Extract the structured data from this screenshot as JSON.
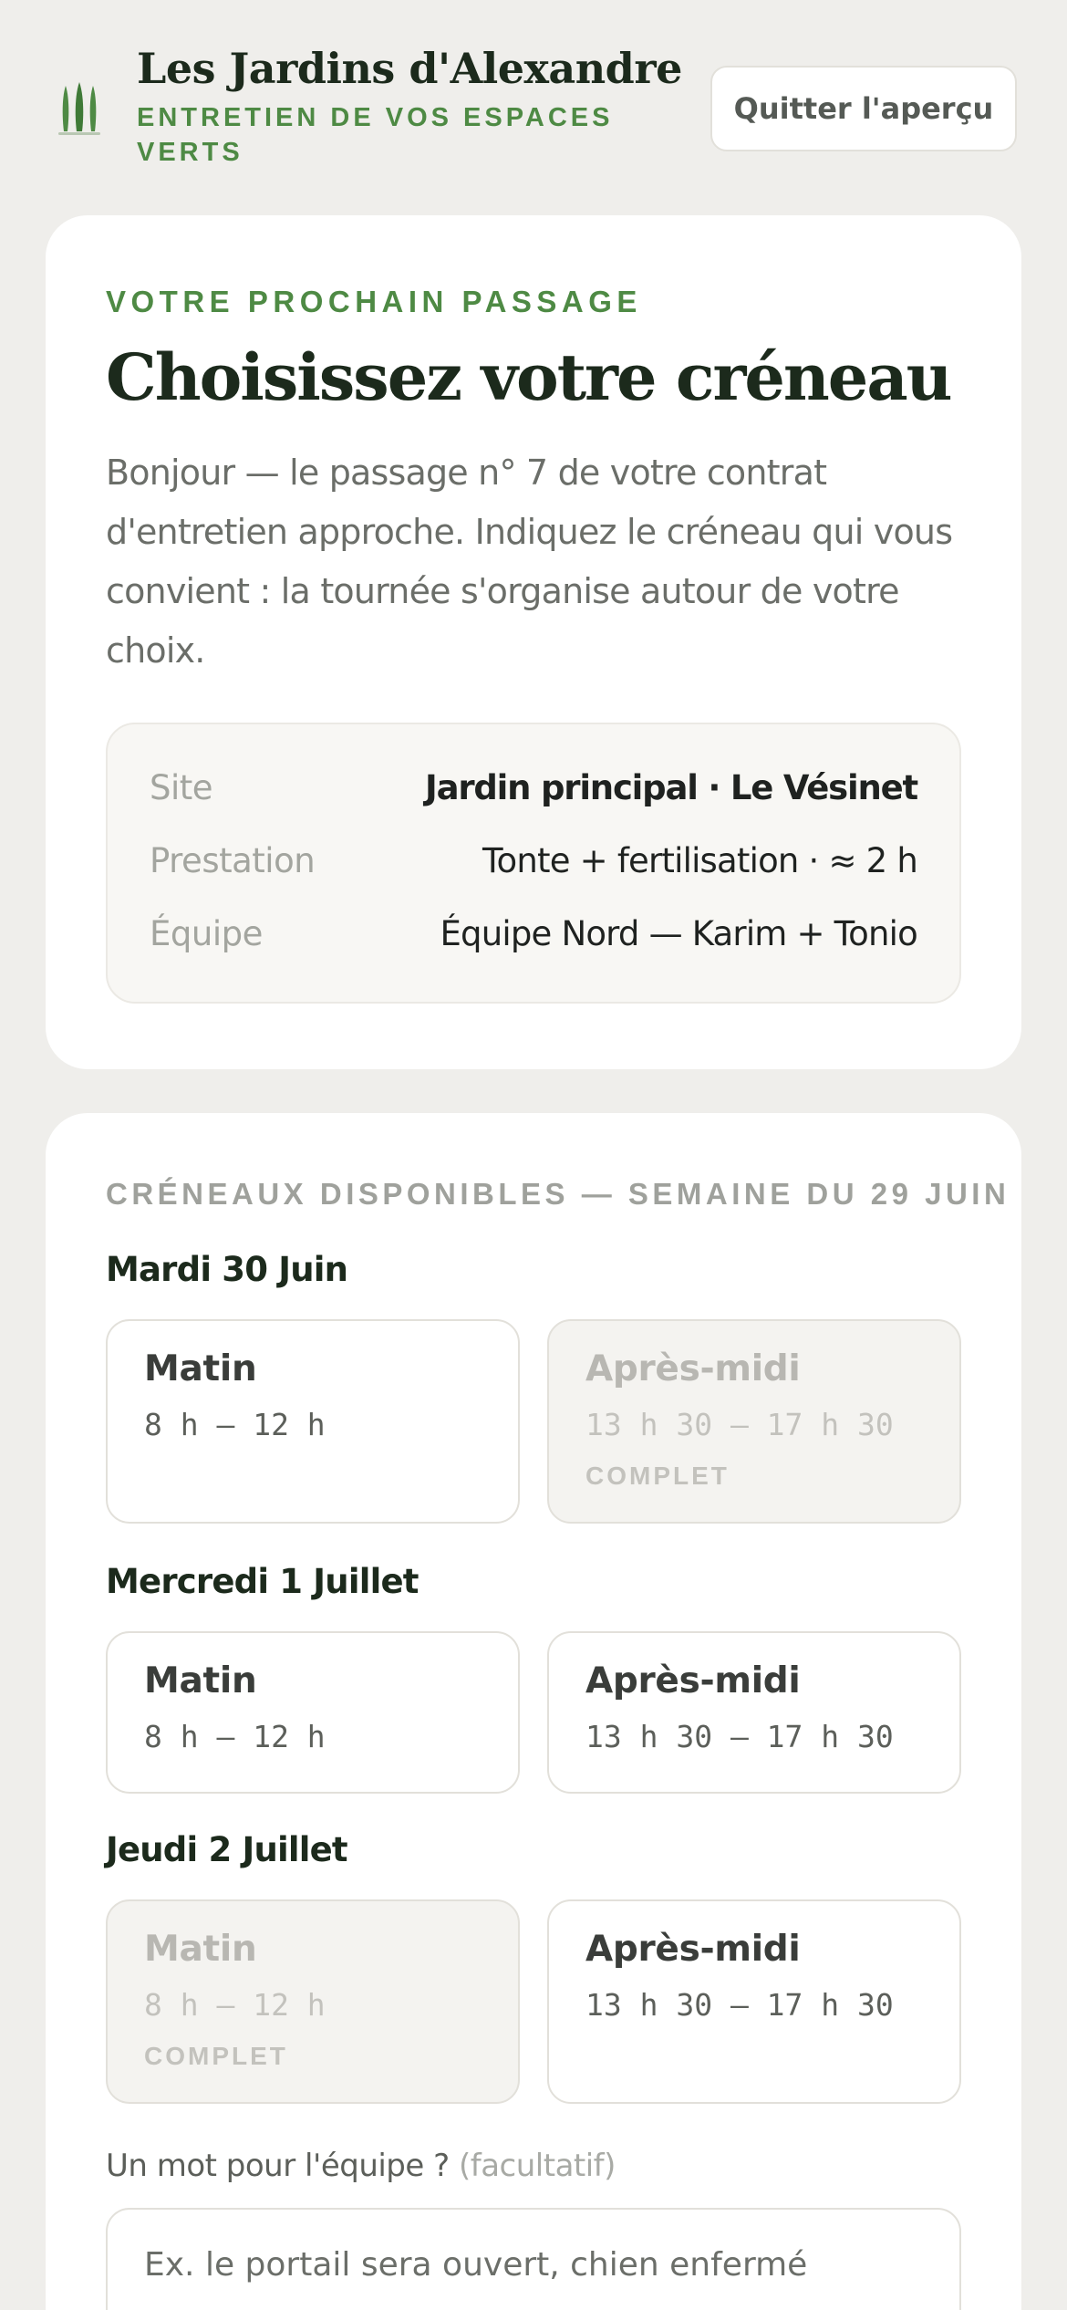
{
  "header": {
    "brand_title": "Les Jardins d'Alexandre",
    "brand_subtitle": "ENTRETIEN DE VOS ESPACES VERTS",
    "logo_icon": "cypress-trees-icon",
    "quit_label": "Quitter l'aperçu"
  },
  "intro_card": {
    "eyebrow": "VOTRE PROCHAIN PASSAGE",
    "title": "Choisissez votre créneau",
    "text": "Bonjour — le passage n° 7 de votre contrat d'entretien approche. Indiquez le créneau qui vous convient : la tournée s'organise autour de votre choix.",
    "details": [
      {
        "label": "Site",
        "value": "Jardin principal · Le Vésinet"
      },
      {
        "label": "Prestation",
        "value": "Tonte + fertilisation · ≈ 2 h"
      },
      {
        "label": "Équipe",
        "value": "Équipe Nord — Karim + Tonio"
      }
    ]
  },
  "slots_card": {
    "section_label": "CRÉNEAUX DISPONIBLES — SEMAINE DU 29 JUIN",
    "days": [
      {
        "title": "Mardi 30 Juin",
        "slots": [
          {
            "name": "Matin",
            "time": "8 h – 12 h",
            "status": ""
          },
          {
            "name": "Après-midi",
            "time": "13 h 30 – 17 h 30",
            "status": "COMPLET"
          }
        ]
      },
      {
        "title": "Mercredi 1 Juillet",
        "slots": [
          {
            "name": "Matin",
            "time": "8 h – 12 h",
            "status": ""
          },
          {
            "name": "Après-midi",
            "time": "13 h 30 – 17 h 30",
            "status": ""
          }
        ]
      },
      {
        "title": "Jeudi 2 Juillet",
        "slots": [
          {
            "name": "Matin",
            "time": "8 h – 12 h",
            "status": "COMPLET"
          },
          {
            "name": "Après-midi",
            "time": "13 h 30 – 17 h 30",
            "status": ""
          }
        ]
      }
    ],
    "note": {
      "label": "Un mot pour l'équipe ?",
      "optional": "(facultatif)",
      "placeholder": "Ex. le portail sera ouvert, chien enfermé",
      "value": ""
    }
  },
  "colors": {
    "accent_green": "#4e8a44",
    "dark_green": "#1c2a1c",
    "background": "#efeeeb"
  }
}
